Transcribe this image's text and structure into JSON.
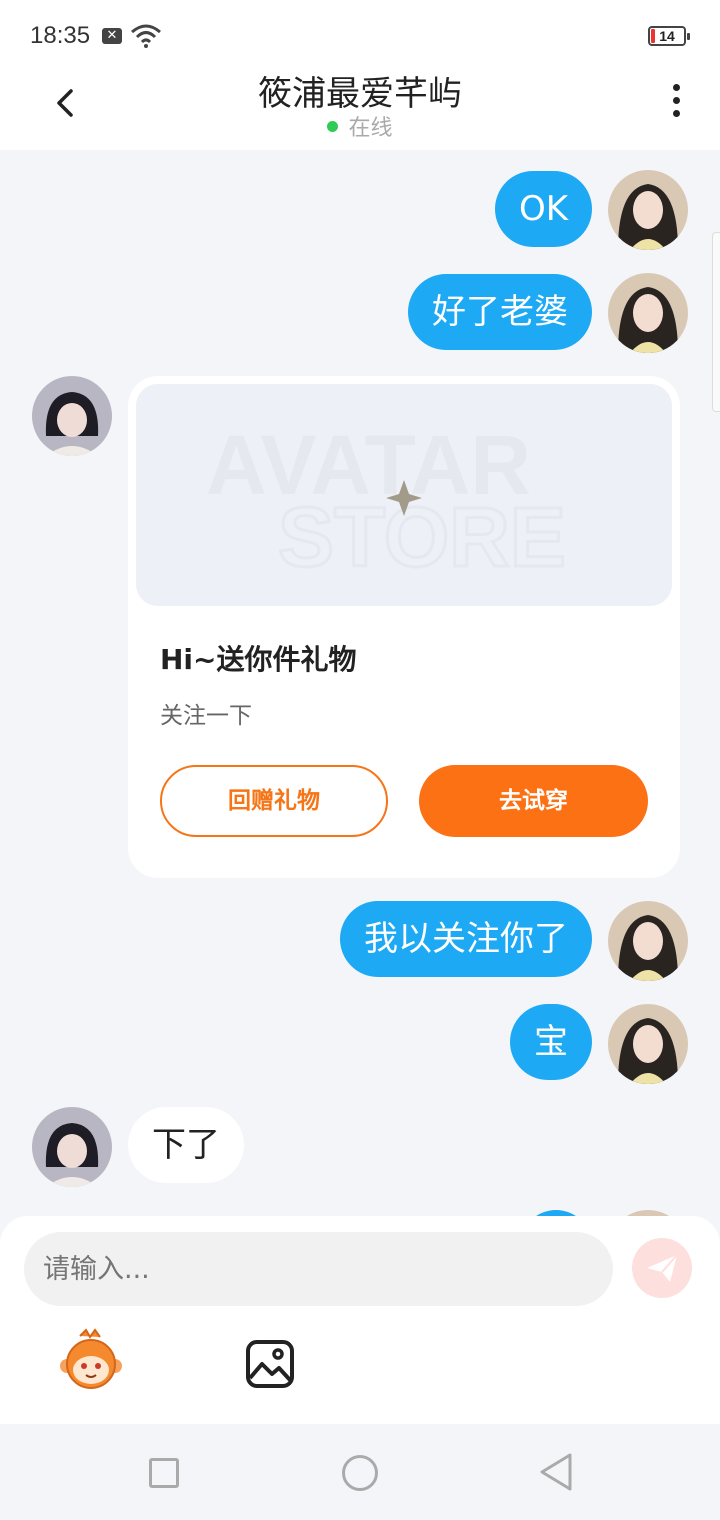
{
  "status_bar": {
    "time": "18:35",
    "battery": "14",
    "battery_level": 0.14
  },
  "header": {
    "title": "筱浦最爱芊屿",
    "status": "在线"
  },
  "messages": [
    {
      "from": "me",
      "text": "OK"
    },
    {
      "from": "me",
      "text": "好了老婆"
    },
    {
      "from": "them",
      "type": "gift-card"
    },
    {
      "from": "me",
      "text": "我以关注你了"
    },
    {
      "from": "me",
      "text": "宝"
    },
    {
      "from": "them",
      "text": "下了"
    }
  ],
  "gift_card": {
    "banner_text_1": "AVATAR",
    "banner_text_2": "STORE",
    "title": "Hi~送你件礼物",
    "subtitle": "关注一下",
    "return_gift_label": "回赠礼物",
    "try_on_label": "去试穿"
  },
  "composer": {
    "placeholder": "请输入..."
  },
  "colors": {
    "my_bubble": "#1ea9f5",
    "accent": "#fb7114",
    "online": "#2ecc55"
  }
}
